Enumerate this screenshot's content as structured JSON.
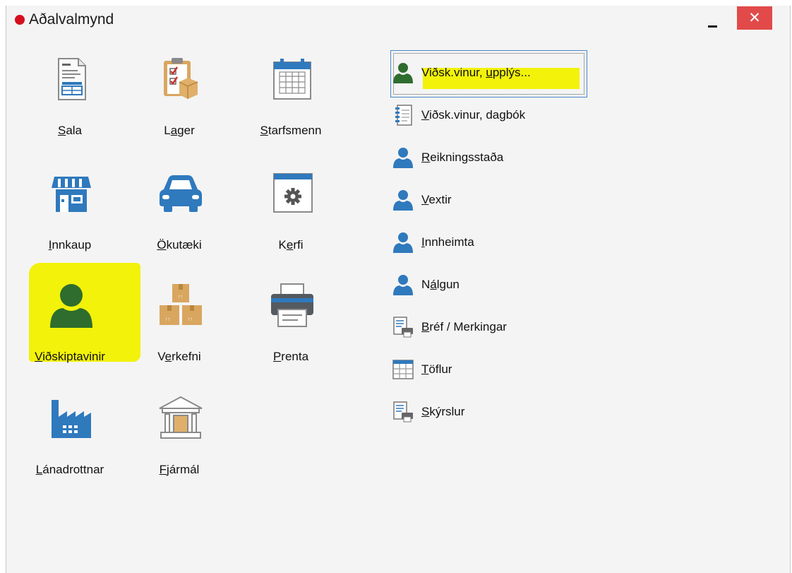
{
  "window": {
    "title": "Aðalvalmynd",
    "close_glyph": "✕"
  },
  "colors": {
    "accent_blue": "#2f79bd",
    "highlight_yellow": "#f2f20a",
    "selected_green": "#2e6d2e",
    "title_dot_red": "#d60f1f",
    "close_red": "#e24a4a"
  },
  "tiles": [
    {
      "label_u": "S",
      "label_rest": "ala",
      "icon": "invoice-icon"
    },
    {
      "label_pre": "L",
      "label_u": "a",
      "label_rest": "ger",
      "icon": "inventory-clipboard-icon"
    },
    {
      "label_u": "S",
      "label_rest": "tarfsmenn",
      "icon": "calendar-icon"
    },
    {
      "label_u": "I",
      "label_rest": "nnkaup",
      "icon": "shop-icon"
    },
    {
      "label_u": "Ö",
      "label_rest": "kutæki",
      "icon": "car-icon"
    },
    {
      "label_pre": "K",
      "label_u": "e",
      "label_rest": "rfi",
      "icon": "settings-window-icon"
    },
    {
      "label_u": "V",
      "label_rest": "iðskiptavinir",
      "icon": "customer-icon"
    },
    {
      "label_pre": "V",
      "label_u": "e",
      "label_rest": "rkefni",
      "icon": "boxes-icon"
    },
    {
      "label_u": "P",
      "label_rest": "renta",
      "icon": "printer-icon"
    },
    {
      "label_u": "L",
      "label_rest": "ánadrottnar",
      "icon": "factory-icon"
    },
    {
      "label_u": "F",
      "label_rest": "jármál",
      "icon": "bank-icon"
    }
  ],
  "list": [
    {
      "label_pre": "Viðsk.vinur, ",
      "label_u": "u",
      "label_rest": "pplýs...",
      "icon": "person-green-icon"
    },
    {
      "label_u": "V",
      "label_rest": "iðsk.vinur, dagbók",
      "icon": "notebook-icon"
    },
    {
      "label_u": "R",
      "label_rest": "eikningsstaða",
      "icon": "person-icon"
    },
    {
      "label_u": "V",
      "label_rest": "extir",
      "icon": "person-icon"
    },
    {
      "label_u": "I",
      "label_rest": "nnheimta",
      "icon": "person-icon"
    },
    {
      "label_pre": "N",
      "label_u": "á",
      "label_rest": "lgun",
      "icon": "person-icon"
    },
    {
      "label_u": "B",
      "label_rest": "réf / Merkingar",
      "icon": "print-document-icon"
    },
    {
      "label_u": "T",
      "label_rest": "öflur",
      "icon": "table-icon"
    },
    {
      "label_u": "S",
      "label_rest": "kýrslur",
      "icon": "print-document-icon"
    }
  ]
}
